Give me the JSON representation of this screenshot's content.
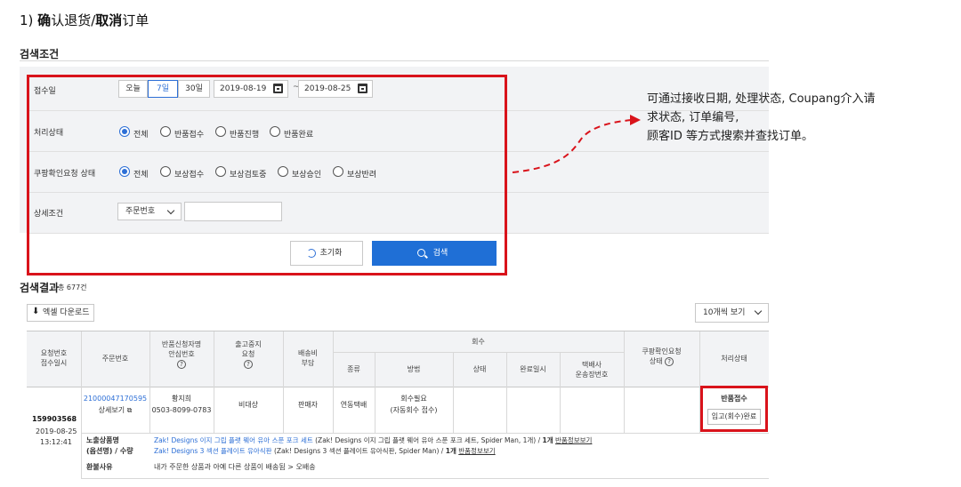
{
  "heading": {
    "prefix": "1) ",
    "bold1": "确",
    "normal1": "认退货/",
    "bold2": "取消",
    "normal2": "订单"
  },
  "search": {
    "title": "검색조건",
    "rows": {
      "received_date": "접수일",
      "status": "처리상태",
      "coupang_status": "쿠팡확인요청 상태",
      "detail": "상세조건"
    },
    "period_buttons": [
      "오늘",
      "7일",
      "30일"
    ],
    "active_period": "7일",
    "date_from": "2019-08-19",
    "date_to": "2019-08-25",
    "tilde": "~",
    "status_options": [
      "전체",
      "반품접수",
      "반품진행",
      "반품완료"
    ],
    "coupang_options": [
      "전체",
      "보상접수",
      "보상검토중",
      "보상승인",
      "보상반려"
    ],
    "detail_select": "주문번호",
    "detail_input_value": "",
    "reset_label": "초기화",
    "search_label": "검색"
  },
  "callout": {
    "line1": "可通过接收日期, 处理状态, Coupang介入请",
    "line2": "求状态, 订单编号,",
    "line3": "顾客ID 等方式搜索并查找订单。"
  },
  "results": {
    "title": "검색결과",
    "count": "총 677건",
    "excel_label": "엑셀 다운로드",
    "page_size": "10개씩 보기",
    "headers": {
      "req_no_1": "요청번호",
      "req_no_2": "접수일시",
      "order_no": "주문번호",
      "applicant_1": "반품신청자명",
      "applicant_2": "안심번호",
      "ship_stop_1": "출고중지",
      "ship_stop_2": "요청",
      "fee_1": "배송비",
      "fee_2": "부담",
      "recall": "회수",
      "type": "종류",
      "method": "방법",
      "state": "상태",
      "done_time": "완료일시",
      "courier_1": "택배사",
      "courier_2": "운송장번호",
      "coupang_req_1": "쿠팡확인요청",
      "coupang_req_2": "상태",
      "process": "처리상태"
    },
    "row": {
      "req_no": "159903568",
      "date": "2019-08-25",
      "time": "13:12:41",
      "order_no": "21000047170595",
      "detail_link": "상세보기",
      "applicant": "황지희",
      "phone": "0503-8099-0783",
      "ship_stop": "비대상",
      "fee": "판매자",
      "type": "연동택배",
      "method_1": "회수필요",
      "method_2": "(자동회수 접수)",
      "status": "반품접수",
      "status_button": "입고(회수)완료",
      "exposed_label_1": "노출상품명",
      "exposed_label_2": "(옵션명) / 수량",
      "product1_link": "Zak! Designs 이지 그립 플랫 웨어 유아 스푼 포크 세트",
      "product1_rest": " (Zak! Designs 이지 그립 플랫 웨어 유아 스푼 포크 세트, Spider Man, 1개) / ",
      "product1_qty": "1개",
      "product1_info": "반품정보보기",
      "product2_link": "Zak! Designs 3 섹션 플레이트 유아식판",
      "product2_rest": " (Zak! Designs 3 섹션 플레이트 유아식판, Spider Man) / ",
      "product2_qty": "1개",
      "product2_info": "반품정보보기",
      "reason_label": "환불사유",
      "reason": "내가 주문한 상품과 아예 다른 상품이 배송됨 > 오배송"
    }
  },
  "colors": {
    "accent": "#2d6fd6",
    "primary_button": "#1f6fd6",
    "highlight": "#d9131b",
    "panel": "#f2f3f5"
  }
}
